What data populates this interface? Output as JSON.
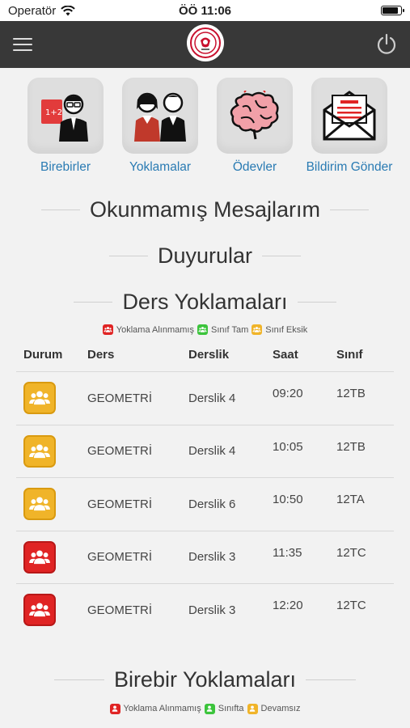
{
  "status_bar": {
    "carrier": "Operatör",
    "time": "ÖÖ 11:06",
    "battery_level": 0.9
  },
  "nav": {
    "menu_icon": "hamburger-icon",
    "logo_icon": "school-logo",
    "power_icon": "power-icon"
  },
  "quick_actions": [
    {
      "label": "Birebirler",
      "icon": "teacher-board-icon"
    },
    {
      "label": "Yoklamalar",
      "icon": "students-icon"
    },
    {
      "label": "Ödevler",
      "icon": "brain-icon"
    },
    {
      "label": "Bildirim Gönder",
      "icon": "envelope-icon"
    }
  ],
  "sections": {
    "unread": "Okunmamış Mesajlarım",
    "announcements": "Duyurular",
    "lesson_attendance": "Ders Yoklamaları",
    "private_attendance": "Birebir Yoklamaları"
  },
  "lesson_legend": [
    {
      "label": "Yoklama Alınmamış",
      "color": "#e02424"
    },
    {
      "label": "Sınıf Tam",
      "color": "#3cc43c"
    },
    {
      "label": "Sınıf Eksik",
      "color": "#f0b429"
    }
  ],
  "lesson_table": {
    "headers": {
      "durum": "Durum",
      "ders": "Ders",
      "derslik": "Derslik",
      "saat": "Saat",
      "sinif": "Sınıf"
    },
    "rows": [
      {
        "status": "eksik",
        "color": "#f0b429",
        "ders": "GEOMETRİ",
        "derslik": "Derslik 4",
        "saat": "09:20",
        "sinif": "12TB"
      },
      {
        "status": "eksik",
        "color": "#f0b429",
        "ders": "GEOMETRİ",
        "derslik": "Derslik 4",
        "saat": "10:05",
        "sinif": "12TB"
      },
      {
        "status": "eksik",
        "color": "#f0b429",
        "ders": "GEOMETRİ",
        "derslik": "Derslik 6",
        "saat": "10:50",
        "sinif": "12TA"
      },
      {
        "status": "alinmamis",
        "color": "#e02424",
        "ders": "GEOMETRİ",
        "derslik": "Derslik 3",
        "saat": "11:35",
        "sinif": "12TC"
      },
      {
        "status": "alinmamis",
        "color": "#e02424",
        "ders": "GEOMETRİ",
        "derslik": "Derslik 3",
        "saat": "12:20",
        "sinif": "12TC"
      }
    ]
  },
  "private_legend": [
    {
      "label": "Yoklama Alınmamış",
      "color": "#e02424"
    },
    {
      "label": "Sınıfta",
      "color": "#3cc43c"
    },
    {
      "label": "Devamsız",
      "color": "#f0b429"
    }
  ]
}
